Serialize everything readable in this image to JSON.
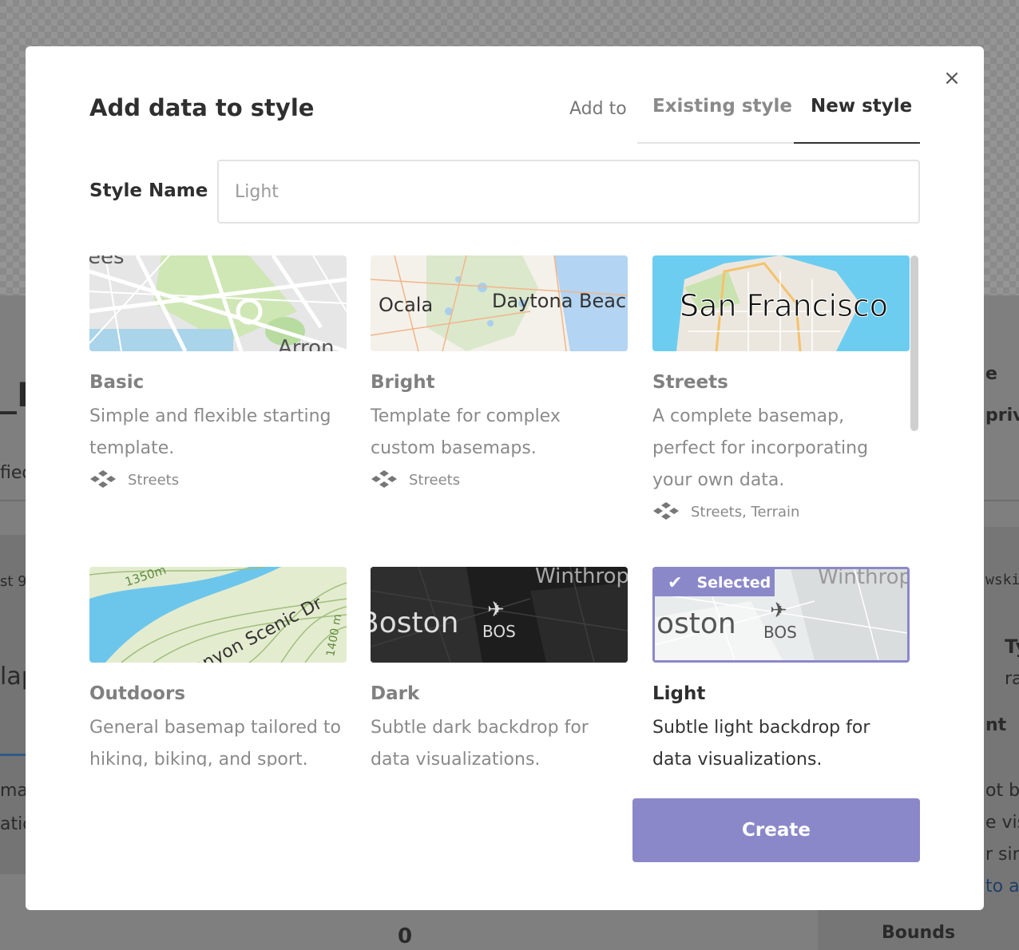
{
  "background": {
    "fragments": [
      "_L",
      "fied",
      "st 9",
      "lap",
      "ma",
      "atio",
      "e",
      "priva",
      "wski",
      "Ty",
      "ra",
      "nt",
      "ot be",
      "e visi",
      "r sim",
      "to ac",
      "0",
      "Bounds"
    ]
  },
  "modal": {
    "title": "Add data to style",
    "close_label": "×",
    "add_to_label": "Add to",
    "tabs": [
      {
        "label": "Existing style",
        "active": false
      },
      {
        "label": "New style",
        "active": true
      }
    ],
    "style_name_label": "Style Name",
    "style_name_placeholder": "Light",
    "create_label": "Create"
  },
  "styles": [
    {
      "name": "Basic",
      "desc_lines": [
        "Simple and flexible starting",
        "template."
      ],
      "sources": "Streets",
      "thumb_text": [
        "ees",
        "Arron"
      ]
    },
    {
      "name": "Bright",
      "desc_lines": [
        "Template for complex",
        "custom basemaps."
      ],
      "sources": "Streets",
      "thumb_text": [
        "Ocala",
        "Daytona Beac"
      ]
    },
    {
      "name": "Streets",
      "desc_lines": [
        "A complete basemap,",
        "perfect for incorporating",
        "your own data."
      ],
      "sources": "Streets, Terrain",
      "thumb_text": [
        "San Francisco"
      ]
    },
    {
      "name": "Outdoors",
      "desc_lines": [
        "General basemap tailored to",
        "hiking, biking, and sport."
      ],
      "thumb_text": [
        "1350m",
        "on Canyon Scenic Dr",
        "1400 m"
      ]
    },
    {
      "name": "Dark",
      "desc_lines": [
        "Subtle dark backdrop for",
        "data visualizations."
      ],
      "thumb_text": [
        "Winthrop",
        "Boston",
        "BOS"
      ]
    },
    {
      "name": "Light",
      "desc_lines": [
        "Subtle light backdrop for",
        "data visualizations."
      ],
      "thumb_text": [
        "Winthrop",
        "oston",
        "BOS"
      ],
      "selected": true,
      "selected_label": "Selected"
    }
  ],
  "colors": {
    "accent": "#8b88c9",
    "title": "#2f2f2f",
    "muted": "#8a8a8a"
  }
}
